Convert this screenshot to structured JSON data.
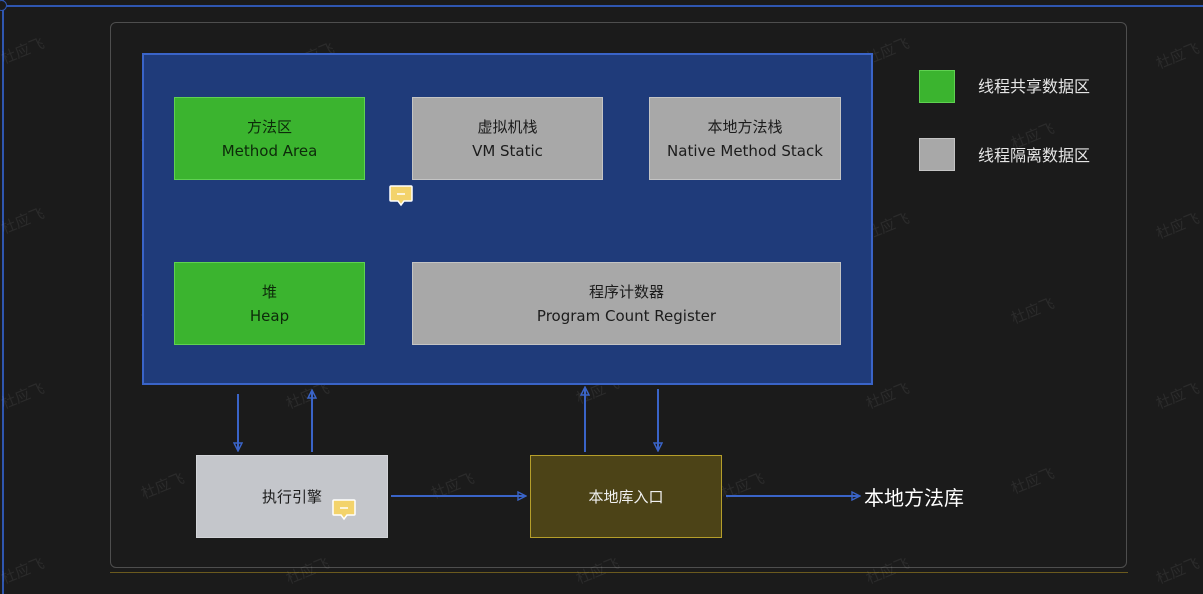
{
  "diagram": {
    "boxes": {
      "method_area": {
        "line1": "方法区",
        "line2": "Method Area"
      },
      "vm_stack": {
        "line1": "虚拟机栈",
        "line2": "VM Static"
      },
      "native_stack": {
        "line1": "本地方法栈",
        "line2": "Native Method Stack"
      },
      "heap": {
        "line1": "堆",
        "line2": "Heap"
      },
      "pc_register": {
        "line1": "程序计数器",
        "line2": "Program Count Register"
      },
      "exec_engine": {
        "label": "执行引擎"
      },
      "native_interface": {
        "label": "本地库入口"
      }
    },
    "native_library_label": "本地方法库",
    "legend": [
      {
        "label": "线程共享数据区",
        "color": "#3bb42f"
      },
      {
        "label": "线程隔离数据区",
        "color": "#a8a8a8"
      }
    ],
    "watermark_text": "杜应飞"
  },
  "colors": {
    "background": "#1b1b1b",
    "runtime_area": "#1f3b7a",
    "shared": "#3bb42f",
    "isolated": "#a8a8a8",
    "arrow": "#3a64c8",
    "comment_marker": "#f3d36b"
  }
}
